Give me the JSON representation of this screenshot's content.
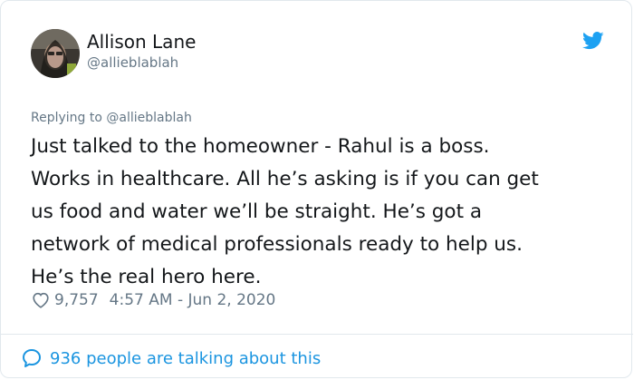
{
  "author": {
    "name": "Allison Lane",
    "handle": "@allieblablah"
  },
  "icons": {
    "brand": "twitter-bird-icon",
    "like": "heart-icon",
    "reply": "speech-bubble-icon",
    "brand_color": "#1da1f2",
    "link_color": "#1b95e0"
  },
  "tweet": {
    "replying_to": "Replying to @allieblablah",
    "lines": [
      "Just talked to the homeowner - Rahul is a boss.",
      "Works in healthcare. All he’s asking is if you can get",
      "us food and water we’ll be straight. He’s got a",
      "network of medical professionals ready to help us.",
      "He’s the real hero here."
    ],
    "likes": "9,757",
    "timestamp": "4:57 AM - Jun 2, 2020"
  },
  "footer": {
    "talking": "936 people are talking about this"
  }
}
